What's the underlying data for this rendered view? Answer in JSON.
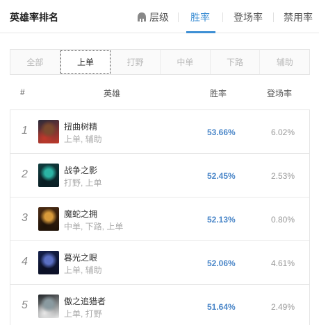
{
  "header": {
    "title": "英雄率排名",
    "tabs": [
      {
        "label": "层级",
        "active": false,
        "icon": "helmet-icon"
      },
      {
        "label": "胜率",
        "active": true
      },
      {
        "label": "登场率",
        "active": false
      },
      {
        "label": "禁用率",
        "active": false
      }
    ]
  },
  "lanes": [
    "全部",
    "上单",
    "打野",
    "中单",
    "下路",
    "辅助"
  ],
  "active_lane": "上单",
  "columns": {
    "rank": "#",
    "hero": "英雄",
    "winrate": "胜率",
    "pickrate": "登场率"
  },
  "rows": [
    {
      "rank": "1",
      "name": "扭曲树精",
      "positions": "上单, 辅助",
      "winrate": "53.66%",
      "pickrate": "6.02%",
      "colors": [
        "#2a2b3a",
        "#7b4a2e",
        "#c0392b"
      ]
    },
    {
      "rank": "2",
      "name": "战争之影",
      "positions": "打野, 上单",
      "winrate": "52.45%",
      "pickrate": "2.53%",
      "colors": [
        "#0f3d3e",
        "#2bb3a3",
        "#0a1c22"
      ]
    },
    {
      "rank": "3",
      "name": "魔蛇之拥",
      "positions": "中单, 下路, 上单",
      "winrate": "52.13%",
      "pickrate": "0.80%",
      "colors": [
        "#4a2a12",
        "#d89a3a",
        "#1e1208"
      ]
    },
    {
      "rank": "4",
      "name": "暮光之眼",
      "positions": "上单, 辅助",
      "winrate": "52.06%",
      "pickrate": "4.61%",
      "colors": [
        "#14204a",
        "#5a6fc4",
        "#0b0f24"
      ]
    },
    {
      "rank": "5",
      "name": "傲之追猎者",
      "positions": "上单, 打野",
      "winrate": "51.64%",
      "pickrate": "2.49%",
      "colors": [
        "#1e2326",
        "#8a9aa0",
        "#e8e8e8"
      ]
    }
  ]
}
